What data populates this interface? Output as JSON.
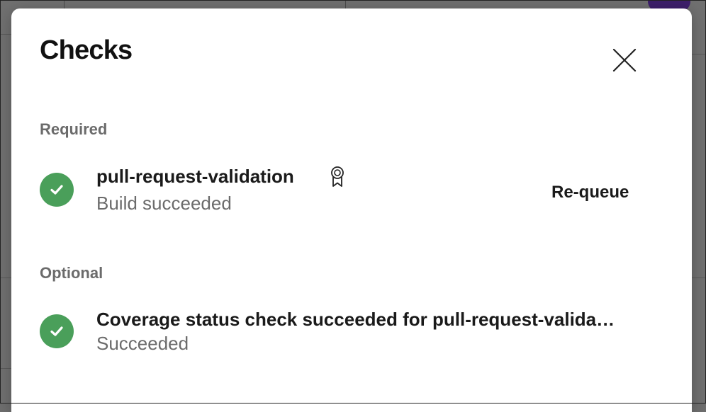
{
  "dialog": {
    "title": "Checks",
    "close_icon": "close-icon"
  },
  "sections": {
    "required": {
      "label": "Required",
      "checks": [
        {
          "name": "pull-request-validation",
          "status": "Build succeeded",
          "status_icon": "check-circle-icon",
          "badge_icon": "ribbon-badge-icon",
          "action_label": "Re-queue"
        }
      ]
    },
    "optional": {
      "label": "Optional",
      "checks": [
        {
          "name": "Coverage status check succeeded for pull-request-valida…",
          "status": "Succeeded",
          "status_icon": "check-circle-icon"
        }
      ]
    }
  },
  "colors": {
    "success": "#4a9f5a",
    "section_label": "#6b6b6b",
    "text_primary": "#1a1a1a",
    "overlay": "#707070"
  }
}
